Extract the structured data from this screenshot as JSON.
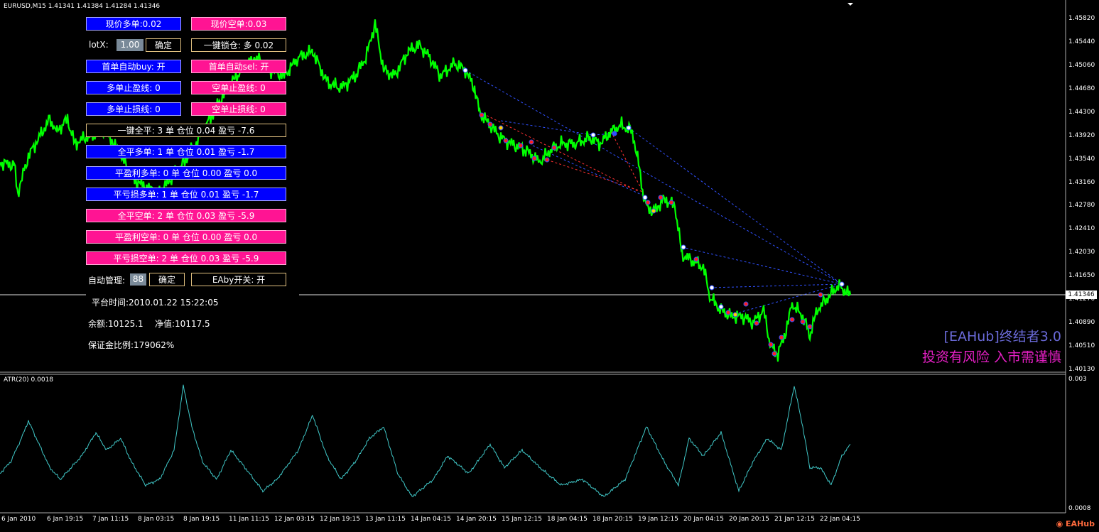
{
  "symbol_header": "EURUSD,M15  1.41341 1.41384 1.41284 1.41346",
  "atr_label": "ATR(20) 0.0018",
  "current_price_tag": "1.41346",
  "price_axis": [
    "1.45820",
    "1.45440",
    "1.45060",
    "1.44680",
    "1.44300",
    "1.43920",
    "1.43540",
    "1.43160",
    "1.42780",
    "1.42410",
    "1.42030",
    "1.41650",
    "1.41270",
    "1.40890",
    "1.40510",
    "1.40130"
  ],
  "atr_axis": [
    "0.003",
    "0.0008"
  ],
  "time_axis": [
    "6 Jan 2010",
    "6 Jan 19:15",
    "7 Jan 11:15",
    "8 Jan 03:15",
    "8 Jan 19:15",
    "11 Jan 11:15",
    "12 Jan 03:15",
    "12 Jan 19:15",
    "13 Jan 11:15",
    "14 Jan 04:15",
    "14 Jan 20:15",
    "15 Jan 12:15",
    "18 Jan 04:15",
    "18 Jan 20:15",
    "19 Jan 12:15",
    "20 Jan 04:15",
    "20 Jan 20:15",
    "21 Jan 12:15",
    "22 Jan 04:15"
  ],
  "panel": {
    "buy_now": "现价多单:0.02",
    "sell_now": "现价空单:0.03",
    "lot_label": "lotX:",
    "lot_value": "1.00",
    "confirm1": "确定",
    "lock": "一键锁仓: 多 0.02",
    "auto_buy": "首单自动buy: 开",
    "auto_sell": "首单自动sel: 开",
    "buy_tp": "多单止盈线: 0",
    "sell_tp": "空单止盈线: 0",
    "buy_sl": "多单止损线: 0",
    "sell_sl": "空单止损线: 0",
    "close_all": "一键全平: 3 单 仓位 0.04 盈亏 -7.6",
    "close_buy": "全平多单: 1 单 仓位 0.01 盈亏 -1.7",
    "close_buy_profit": "平盈利多单: 0 单 仓位 0.00 盈亏 0.0",
    "close_buy_loss": "平亏损多单: 1 单 仓位 0.01 盈亏 -1.7",
    "close_sell": "全平空单: 2 单 仓位 0.03 盈亏 -5.9",
    "close_sell_profit": "平盈利空单: 0 单 仓位 0.00 盈亏 0.0",
    "close_sell_loss": "平亏损空单: 2 单 仓位 0.03 盈亏 -5.9",
    "auto_mgmt_label": "自动管理:",
    "auto_mgmt_value": "88",
    "confirm2": "确定",
    "eaby": "EAby开关: 开",
    "platform_time": "平台时间:2010.01.22 15:22:05",
    "balance": "余额:10125.1",
    "equity": "净值:10117.5",
    "margin_ratio": "保证金比例:179062%"
  },
  "watermark_line1": "[EAHub]终结者3.0",
  "watermark_line2": "投资有风险 入市需谨慎",
  "logo_text": "EAHub",
  "colors": {
    "price_line": "#00ff00",
    "atr_line": "#40c8c8",
    "buy_btn": "#0000ff",
    "sell_btn": "#ff1493",
    "trade_line_buy": "#3050ff",
    "trade_line_sell": "#ff3030"
  },
  "chart_data": {
    "type": "line",
    "title": "EURUSD,M15",
    "price_ylim": [
      1.4013,
      1.4582
    ],
    "price_series": [
      [
        0,
        1.435
      ],
      [
        20,
        1.4345
      ],
      [
        25,
        1.43
      ],
      [
        40,
        1.436
      ],
      [
        55,
        1.439
      ],
      [
        70,
        1.442
      ],
      [
        80,
        1.44
      ],
      [
        95,
        1.442
      ],
      [
        105,
        1.438
      ],
      [
        120,
        1.439
      ],
      [
        135,
        1.4395
      ],
      [
        150,
        1.44
      ],
      [
        170,
        1.436
      ],
      [
        190,
        1.432
      ],
      [
        205,
        1.431
      ],
      [
        225,
        1.43
      ],
      [
        245,
        1.433
      ],
      [
        260,
        1.435
      ],
      [
        280,
        1.439
      ],
      [
        300,
        1.443
      ],
      [
        320,
        1.447
      ],
      [
        340,
        1.45
      ],
      [
        360,
        1.452
      ],
      [
        380,
        1.45
      ],
      [
        400,
        1.449
      ],
      [
        420,
        1.452
      ],
      [
        440,
        1.453
      ],
      [
        460,
        1.448
      ],
      [
        480,
        1.447
      ],
      [
        500,
        1.449
      ],
      [
        515,
        1.452
      ],
      [
        528,
        1.4575
      ],
      [
        540,
        1.45
      ],
      [
        555,
        1.449
      ],
      [
        575,
        1.453
      ],
      [
        590,
        1.454
      ],
      [
        605,
        1.452
      ],
      [
        620,
        1.449
      ],
      [
        640,
        1.451
      ],
      [
        655,
        1.45
      ],
      [
        668,
        1.447
      ],
      [
        675,
        1.443
      ],
      [
        690,
        1.441
      ],
      [
        705,
        1.439
      ],
      [
        720,
        1.438
      ],
      [
        740,
        1.437
      ],
      [
        760,
        1.435
      ],
      [
        775,
        1.437
      ],
      [
        790,
        1.438
      ],
      [
        810,
        1.438
      ],
      [
        830,
        1.439
      ],
      [
        845,
        1.438
      ],
      [
        860,
        1.44
      ],
      [
        875,
        1.441
      ],
      [
        890,
        1.44
      ],
      [
        900,
        1.434
      ],
      [
        908,
        1.428
      ],
      [
        920,
        1.427
      ],
      [
        935,
        1.429
      ],
      [
        950,
        1.428
      ],
      [
        960,
        1.42
      ],
      [
        975,
        1.419
      ],
      [
        990,
        1.418
      ],
      [
        1000,
        1.413
      ],
      [
        1015,
        1.411
      ],
      [
        1030,
        1.41
      ],
      [
        1045,
        1.41
      ],
      [
        1060,
        1.409
      ],
      [
        1075,
        1.411
      ],
      [
        1085,
        1.405
      ],
      [
        1095,
        1.404
      ],
      [
        1105,
        1.407
      ],
      [
        1115,
        1.412
      ],
      [
        1130,
        1.41
      ],
      [
        1140,
        1.407
      ],
      [
        1150,
        1.411
      ],
      [
        1165,
        1.413
      ],
      [
        1180,
        1.415
      ],
      [
        1190,
        1.414
      ],
      [
        1197,
        1.4135
      ]
    ],
    "atr_series": [
      [
        0,
        0.0014
      ],
      [
        15,
        0.0016
      ],
      [
        30,
        0.002
      ],
      [
        40,
        0.0023
      ],
      [
        55,
        0.0019
      ],
      [
        70,
        0.0015
      ],
      [
        85,
        0.0013
      ],
      [
        100,
        0.0015
      ],
      [
        115,
        0.0017
      ],
      [
        135,
        0.0021
      ],
      [
        150,
        0.0018
      ],
      [
        170,
        0.002
      ],
      [
        185,
        0.0016
      ],
      [
        205,
        0.0012
      ],
      [
        225,
        0.0013
      ],
      [
        245,
        0.0018
      ],
      [
        258,
        0.0029
      ],
      [
        270,
        0.0022
      ],
      [
        285,
        0.0016
      ],
      [
        305,
        0.0013
      ],
      [
        325,
        0.0018
      ],
      [
        345,
        0.0015
      ],
      [
        370,
        0.0011
      ],
      [
        390,
        0.0013
      ],
      [
        420,
        0.0018
      ],
      [
        440,
        0.0024
      ],
      [
        460,
        0.0017
      ],
      [
        480,
        0.0013
      ],
      [
        500,
        0.0016
      ],
      [
        520,
        0.002
      ],
      [
        540,
        0.0022
      ],
      [
        560,
        0.0014
      ],
      [
        580,
        0.001
      ],
      [
        610,
        0.0013
      ],
      [
        630,
        0.0017
      ],
      [
        660,
        0.0014
      ],
      [
        690,
        0.0019
      ],
      [
        710,
        0.0015
      ],
      [
        735,
        0.0018
      ],
      [
        760,
        0.0015
      ],
      [
        790,
        0.0012
      ],
      [
        820,
        0.0013
      ],
      [
        850,
        0.001
      ],
      [
        880,
        0.0013
      ],
      [
        910,
        0.0022
      ],
      [
        935,
        0.0016
      ],
      [
        955,
        0.0012
      ],
      [
        970,
        0.002
      ],
      [
        990,
        0.0017
      ],
      [
        1015,
        0.0021
      ],
      [
        1040,
        0.0011
      ],
      [
        1060,
        0.0016
      ],
      [
        1080,
        0.002
      ],
      [
        1100,
        0.0018
      ],
      [
        1118,
        0.0029
      ],
      [
        1130,
        0.0022
      ],
      [
        1140,
        0.0015
      ],
      [
        1155,
        0.0015
      ],
      [
        1170,
        0.0012
      ],
      [
        1185,
        0.0017
      ],
      [
        1197,
        0.0019
      ]
    ],
    "atr_ylim": [
      0.0008,
      0.003
    ]
  }
}
